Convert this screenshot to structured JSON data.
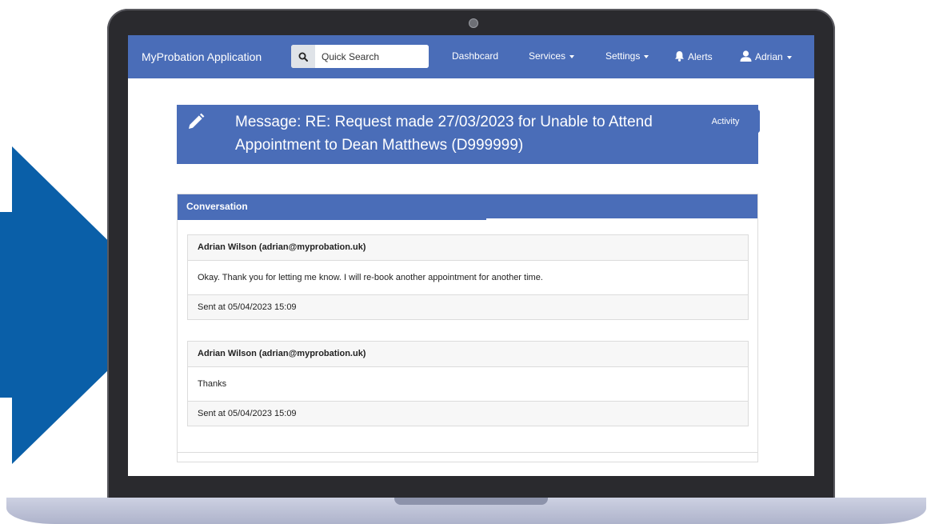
{
  "colors": {
    "brand": "#4a6db8",
    "arrow": "#0a5fa8",
    "laptop_bezel": "#2a2a2e",
    "laptop_base": "#bfc4da"
  },
  "navbar": {
    "brand": "MyProbation Application",
    "search_icon": "search-icon",
    "search_placeholder": "Quick Search",
    "items": [
      {
        "label": "Dashbcard",
        "dropdown": false
      },
      {
        "label": "Services",
        "dropdown": true
      },
      {
        "label": "Settings",
        "dropdown": true
      },
      {
        "label": "Alerts",
        "icon": "bell-icon",
        "dropdown": false
      },
      {
        "label": "Adrian",
        "icon": "user-icon",
        "dropdown": true
      }
    ]
  },
  "header": {
    "icon": "pencil-icon",
    "title_line1": "Message: RE: Request made 27/03/2023 for Unable to Attend",
    "title_line2": "Appointment to Dean Matthews (D999999)",
    "activity_label": "Activity"
  },
  "conversation": {
    "title": "Conversation",
    "messages": [
      {
        "from": "Adrian Wilson (adrian@myprobation.uk)",
        "body": "Okay. Thank you for letting me know. I will re-book another appointment for another time.",
        "sent": "Sent at 05/04/2023 15:09"
      },
      {
        "from": "Adrian Wilson (adrian@myprobation.uk)",
        "body": "Thanks",
        "sent": "Sent at 05/04/2023 15:09"
      }
    ]
  }
}
